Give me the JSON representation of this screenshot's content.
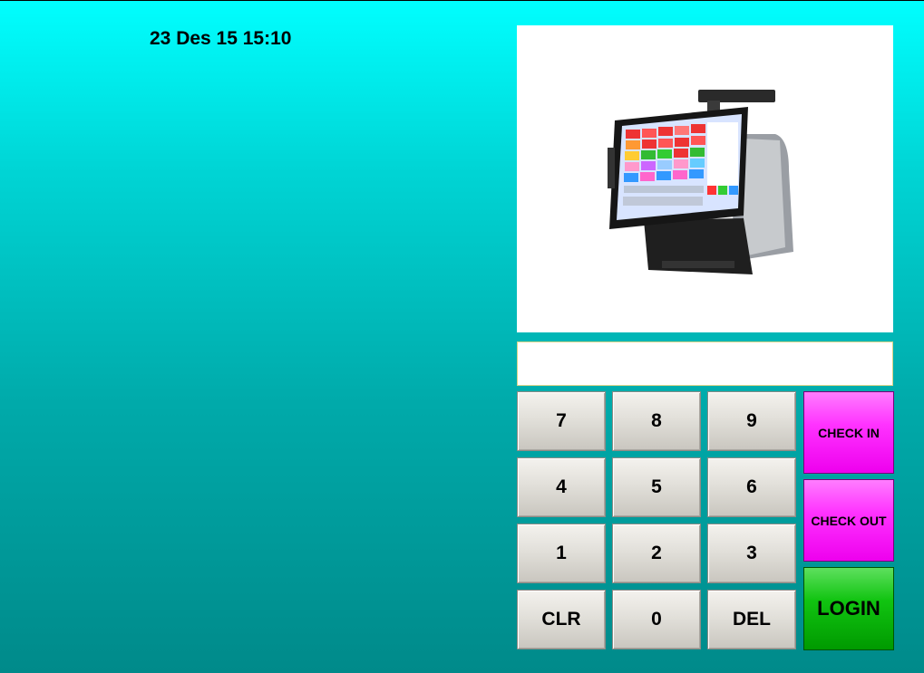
{
  "header": {
    "datetime": "23 Des 15 15:10"
  },
  "display": {
    "value": ""
  },
  "keypad": {
    "k7": "7",
    "k8": "8",
    "k9": "9",
    "k4": "4",
    "k5": "5",
    "k6": "6",
    "k1": "1",
    "k2": "2",
    "k3": "3",
    "clr": "CLR",
    "k0": "0",
    "del": "DEL"
  },
  "actions": {
    "check_in": "CHECK IN",
    "check_out": "CHECK OUT",
    "login": "LOGIN"
  },
  "colors": {
    "background_top": "#00ffff",
    "background_bottom": "#008a8a",
    "check_button": "#ff33ff",
    "login_button": "#11c411"
  },
  "icons": {
    "product_image": "pos-terminal-image"
  }
}
